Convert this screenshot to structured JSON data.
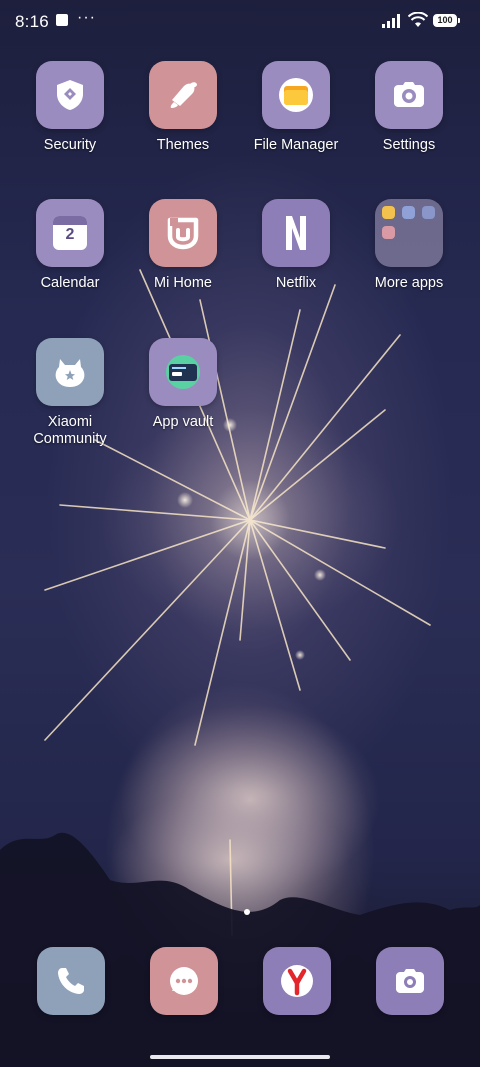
{
  "status_bar": {
    "time": "8:16",
    "more": "···",
    "battery": "100"
  },
  "apps": {
    "security": "Security",
    "themes": "Themes",
    "file_manager": "File Manager",
    "settings": "Settings",
    "calendar": "Calendar",
    "calendar_day": "2",
    "mi_home": "Mi Home",
    "netflix": "Netflix",
    "more_apps": "More apps",
    "xiaomi_community_line1": "Xiaomi",
    "xiaomi_community_line2": "Community",
    "app_vault": "App vault"
  },
  "dock": [
    "Phone",
    "Messages",
    "Yandex Browser",
    "Camera"
  ],
  "icons": {
    "security": "shield-icon",
    "themes": "paint-brush-icon",
    "file_manager": "folder-icon",
    "settings": "camera-gear-icon",
    "calendar": "calendar-icon",
    "mi_home": "mi-home-icon",
    "netflix": "netflix-logo-icon",
    "xiaomi_community": "bunny-icon",
    "app_vault": "card-icon"
  },
  "colors": {
    "icon_purple": "#9b8cc0",
    "icon_pink": "#d09498",
    "icon_blue": "#8fa1b9",
    "wallpaper_sky": "#262a52"
  },
  "page_indicator": {
    "current": 1,
    "total": 1
  }
}
